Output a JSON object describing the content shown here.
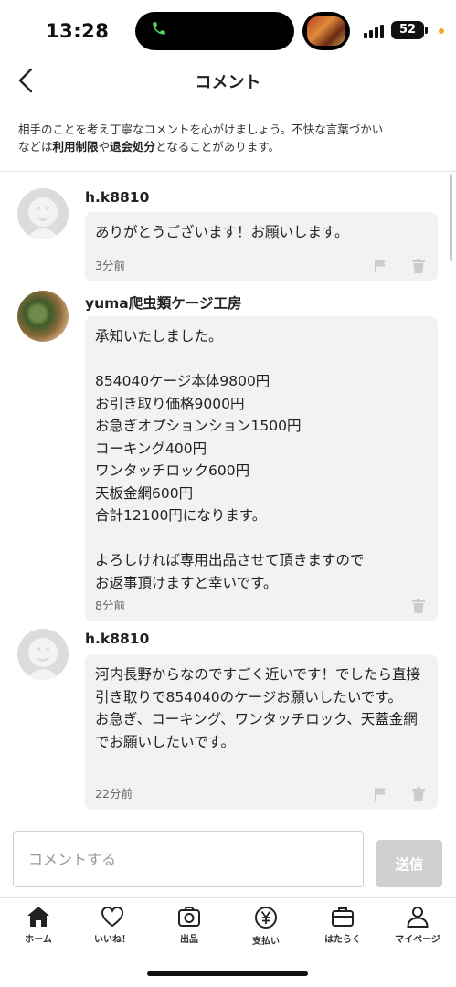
{
  "status_bar": {
    "time": "13:28",
    "battery": "52"
  },
  "header": {
    "title": "コメント"
  },
  "notice": {
    "part1": "相手のことを考え丁寧なコメントを心がけましょう。不快な言葉づかい",
    "part2": "などは",
    "bold1": "利用制限",
    "part3": "や",
    "bold2": "退会処分",
    "part4": "となることがあります。"
  },
  "comments": [
    {
      "username": "h.k8810",
      "text": "ありがとうございます！お願いします。",
      "time": "3分前"
    },
    {
      "username": "yuma爬虫類ケージ工房",
      "text": "承知いたしました。\n\n854040ケージ本体9800円\nお引き取り価格9000円\nお急ぎオプションション1500円\nコーキング400円\nワンタッチロック600円\n天板金網600円\n合計12100円になります。\n\nよろしければ専用出品させて頂きますので\nお返事頂けますと幸いです。",
      "time": "8分前"
    },
    {
      "username": "h.k8810",
      "text": "河内長野からなのですごく近いです！でしたら直接引き取りで854040のケージお願いしたいです。\nお急ぎ、コーキング、ワンタッチロック、天蓋金網でお願いしたいです。",
      "time": "22分前"
    }
  ],
  "input": {
    "placeholder": "コメントする",
    "send_label": "送信"
  },
  "tabs": [
    {
      "label": "ホーム",
      "icon": "home-icon"
    },
    {
      "label": "いいね！",
      "icon": "heart-icon"
    },
    {
      "label": "出品",
      "icon": "camera-icon"
    },
    {
      "label": "支払い",
      "icon": "yen-icon"
    },
    {
      "label": "はたらく",
      "icon": "briefcase-icon"
    },
    {
      "label": "マイページ",
      "icon": "person-icon"
    }
  ],
  "colors": {
    "send_button": "#d0d0d0",
    "bubble": "#f2f2f2",
    "call_indicator": "#4cd964"
  }
}
